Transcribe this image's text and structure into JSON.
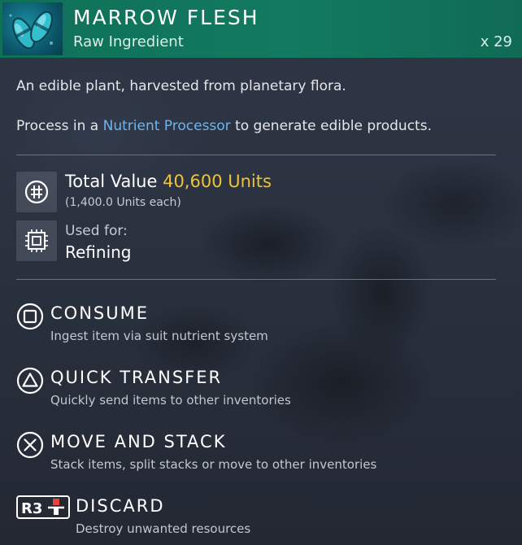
{
  "item": {
    "name": "MARROW FLESH",
    "category": "Raw Ingredient",
    "quantity": "x 29",
    "icon": "marrow-flesh-icon",
    "header_color": "#127a60"
  },
  "description": {
    "line1": "An edible plant, harvested from planetary flora.",
    "line2_before": "Process in a ",
    "line2_link": "Nutrient Processor",
    "line2_after": " to generate edible products.",
    "link_color": "#6fb4ec"
  },
  "value": {
    "label": "Total Value ",
    "amount": "40,600 Units",
    "each": "(1,400.0 Units each)",
    "icon": "units-currency-icon",
    "amount_color": "#f0c239"
  },
  "used_for": {
    "label": "Used for:",
    "value": "Refining",
    "icon": "refiner-chip-icon"
  },
  "actions": [
    {
      "title": "CONSUME",
      "subtitle": "Ingest item via suit nutrient system",
      "icon": "square-button-icon"
    },
    {
      "title": "QUICK TRANSFER",
      "subtitle": "Quickly send items to other inventories",
      "icon": "triangle-button-icon"
    },
    {
      "title": "MOVE AND STACK",
      "subtitle": "Stack items, split stacks or move to other inventories",
      "icon": "cross-button-icon"
    },
    {
      "title": "DISCARD",
      "subtitle": "Destroy unwanted resources",
      "icon": "r3-button-icon",
      "button_label": "R3"
    }
  ]
}
